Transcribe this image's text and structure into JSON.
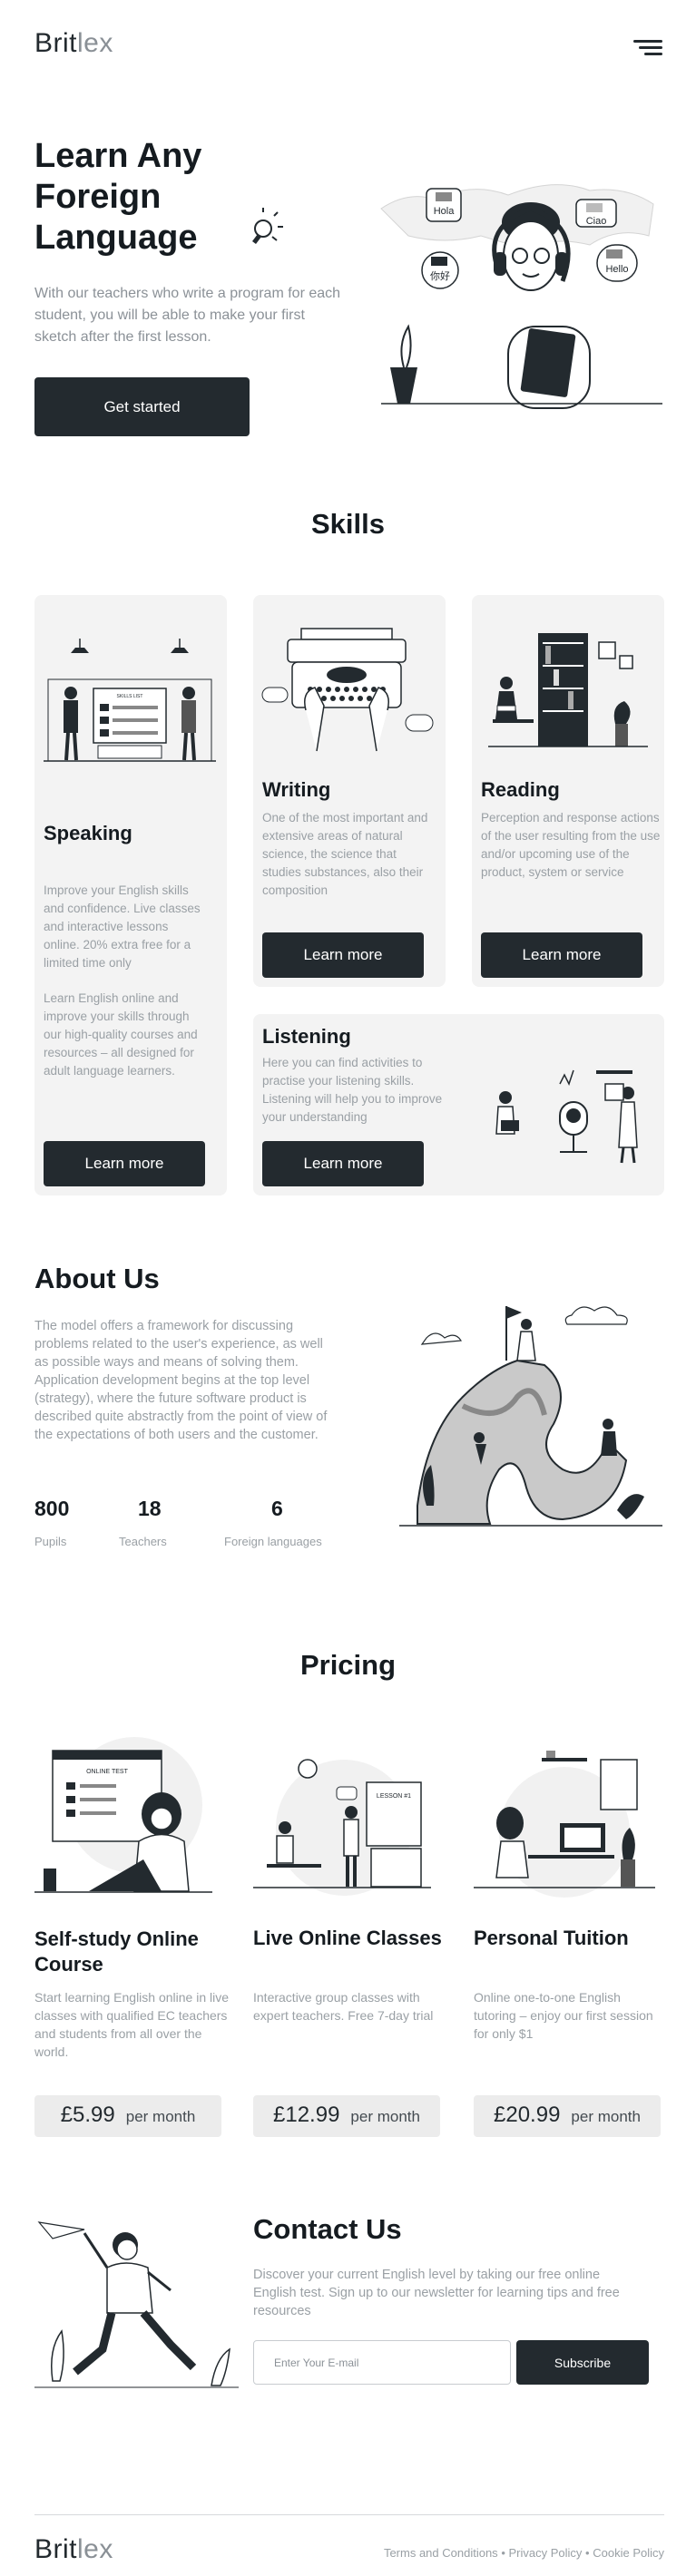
{
  "brand": {
    "name_bold": "Brit",
    "name_light": "lex"
  },
  "nav": {
    "menu_icon": "hamburger-icon"
  },
  "hero": {
    "title_lines": [
      "Learn Any",
      "Foreign",
      "Language"
    ],
    "description": "With our teachers who write a program for each student, you will be able to make your first sketch after the first lesson.",
    "cta_label": "Get started",
    "bubbles": [
      "Hola",
      "Ciao",
      "你好",
      "Hello"
    ]
  },
  "skills": {
    "title": "Skills",
    "speaking": {
      "title": "Speaking",
      "text1": "Improve your English skills and confidence. Live classes and interactive lessons online. 20% extra free for a limited time only",
      "text2": "Learn English online and improve your skills through our high-quality courses and resources – all designed for adult language learners.",
      "button": "Learn more",
      "board_label": "SKILLS LIST"
    },
    "writing": {
      "title": "Writing",
      "text": "One of the most important and extensive areas of natural science, the science that studies substances, also their composition",
      "button": "Learn more"
    },
    "reading": {
      "title": "Reading",
      "text": "Perception and response actions of the user resulting from the use and/or upcoming use of the product, system or service",
      "button": "Learn more"
    },
    "listening": {
      "title": "Listening",
      "text": "Here you can find activities to practise your listening skills. Listening will help you to improve your understanding",
      "button": "Learn more"
    }
  },
  "about": {
    "title": "About Us",
    "text": "The model offers a framework for discussing problems related to the user's experience, as well as possible ways and means of solving them. Application development begins at the top level (strategy), where the future software product is described quite abstractly from the point of view of the expectations of both users and the customer.",
    "stats": [
      {
        "value": "800",
        "label": "Pupils"
      },
      {
        "value": "18",
        "label": "Teachers"
      },
      {
        "value": "6",
        "label": "Foreign languages"
      }
    ]
  },
  "pricing": {
    "title": "Pricing",
    "plans": [
      {
        "title": "Self-study Online Course",
        "text": "Start learning English online in live classes with qualified EC teachers and students from all over the world.",
        "price": "£5.99",
        "per": "per month",
        "illustration_label": "ONLINE TEST"
      },
      {
        "title": "Live Online Classes",
        "text": "Interactive group classes with expert teachers. Free 7-day trial",
        "price": "£12.99",
        "per": "per month",
        "illustration_label": "LESSON #1"
      },
      {
        "title": "Personal Tuition",
        "text": "Online one-to-one English tutoring – enjoy our first session for only $1",
        "price": "£20.99",
        "per": "per month"
      }
    ]
  },
  "contact": {
    "title": "Contact Us",
    "text": "Discover your current English level by taking our free online English test. Sign up to our newsletter for learning tips and free resources",
    "email_placeholder": "Enter Your E-mail",
    "subscribe_label": "Subscribe"
  },
  "footer": {
    "links": [
      "Terms and Conditions",
      "Privacy Policy",
      "Cookie Policy"
    ],
    "separator": "•"
  }
}
